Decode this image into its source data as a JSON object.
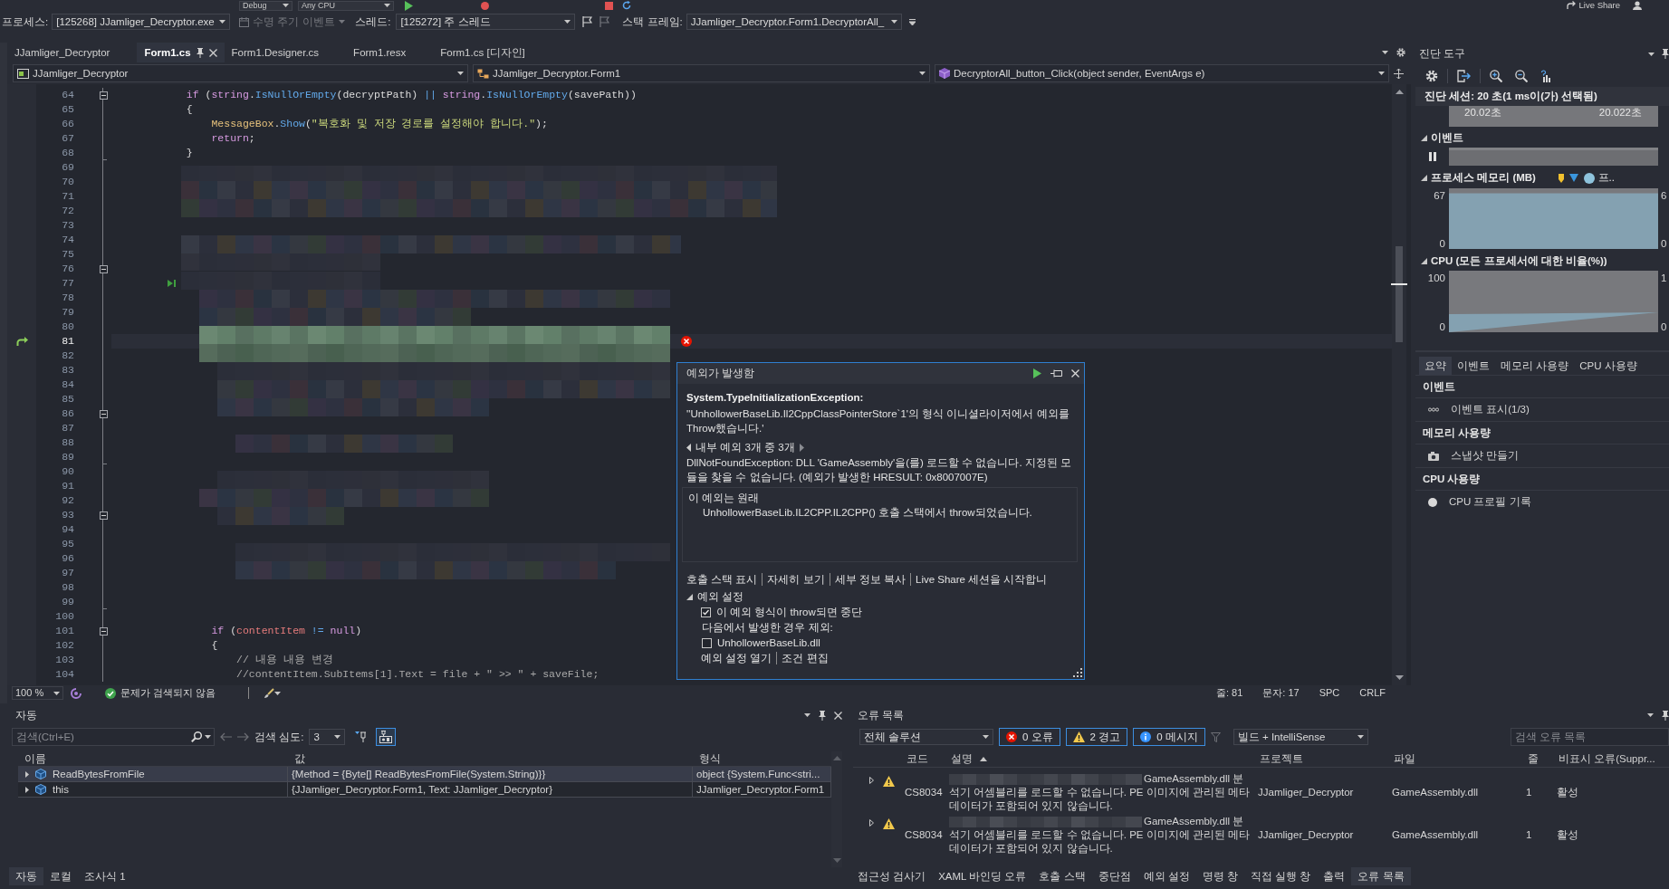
{
  "toolbar": {
    "configuration": "Debug",
    "platform": "Any CPU",
    "live_share": "Live Share"
  },
  "debug_location": {
    "process_label": "프로세스:",
    "process": "[125268] JJamliger_Decryptor.exe",
    "lifecycle_events": "수명 주기 이벤트",
    "thread_label": "스레드:",
    "thread": "[125272] 주 스레드",
    "stack_frame_label": "스택 프레임:",
    "stack_frame": "JJamliger_Decryptor.Form1.DecryptorAll_"
  },
  "editor": {
    "tabs": [
      {
        "label": "JJamliger_Decryptor",
        "selected": false
      },
      {
        "label": "Form1.cs",
        "selected": true
      },
      {
        "label": "Form1.Designer.cs",
        "selected": false
      },
      {
        "label": "Form1.resx",
        "selected": false
      },
      {
        "label": "Form1.cs [디자인]",
        "selected": false
      }
    ],
    "navigation": {
      "project": "JJamliger_Decryptor",
      "type": "JJamliger_Decryptor.Form1",
      "member": "DecryptorAll_button_Click(object sender, EventArgs e)"
    },
    "lines": [
      {
        "number": "64",
        "kind": "opener",
        "current": false,
        "hovered": false,
        "tokens": [
          {
            "kind": "keyword",
            "text": "            if"
          },
          {
            "kind": "plain",
            "text": " ("
          },
          {
            "kind": "keyword",
            "text": "string"
          },
          {
            "kind": "plain",
            "text": "."
          },
          {
            "kind": "method",
            "text": "IsNullOrEmpty"
          },
          {
            "kind": "plain",
            "text": "(decryptPath) "
          },
          {
            "kind": "operator",
            "text": "|| "
          },
          {
            "kind": "keyword",
            "text": "string"
          },
          {
            "kind": "plain",
            "text": "."
          },
          {
            "kind": "method",
            "text": "IsNullOrEmpty"
          },
          {
            "kind": "plain",
            "text": "(savePath))"
          }
        ]
      },
      {
        "number": "65",
        "kind": "plain",
        "current": false,
        "hovered": false,
        "tokens": [
          {
            "kind": "plain",
            "text": "            {"
          }
        ]
      },
      {
        "number": "66",
        "kind": "plain",
        "current": false,
        "hovered": false,
        "tokens": [
          {
            "kind": "type",
            "text": "                MessageBox"
          },
          {
            "kind": "plain",
            "text": "."
          },
          {
            "kind": "method",
            "text": "Show"
          },
          {
            "kind": "plain",
            "text": "("
          },
          {
            "kind": "string",
            "text": "\"복호화 및 저장 경로를 설정해야 합니다.\""
          },
          {
            "kind": "plain",
            "text": ");"
          }
        ]
      },
      {
        "number": "67",
        "kind": "plain",
        "current": false,
        "hovered": false,
        "tokens": [
          {
            "kind": "keyword",
            "text": "                return"
          },
          {
            "kind": "plain",
            "text": ";"
          }
        ]
      },
      {
        "number": "68",
        "kind": "closer",
        "current": false,
        "hovered": false,
        "tokens": [
          {
            "kind": "plain",
            "text": "            }"
          }
        ]
      },
      {
        "number": "69",
        "kind": "plain",
        "current": false,
        "hovered": false
      },
      {
        "number": "70",
        "kind": "plain",
        "current": false,
        "hovered": false
      },
      {
        "number": "71",
        "kind": "plain",
        "current": false,
        "hovered": false
      },
      {
        "number": "72",
        "kind": "plain",
        "current": false,
        "hovered": false
      },
      {
        "number": "73",
        "kind": "plain",
        "current": false,
        "hovered": false
      },
      {
        "number": "74",
        "kind": "plain",
        "current": false,
        "hovered": false
      },
      {
        "number": "75",
        "kind": "plain",
        "current": false,
        "hovered": false
      },
      {
        "number": "76",
        "kind": "opener",
        "current": false,
        "hovered": false
      },
      {
        "number": "77",
        "kind": "plain",
        "current": false,
        "hovered": true
      },
      {
        "number": "78",
        "kind": "plain",
        "current": false,
        "hovered": false
      },
      {
        "number": "79",
        "kind": "plain",
        "current": false,
        "hovered": false
      },
      {
        "number": "80",
        "kind": "plain",
        "current": false,
        "hovered": false
      },
      {
        "number": "81",
        "kind": "plain",
        "current": true,
        "hovered": false
      },
      {
        "number": "82",
        "kind": "plain",
        "current": false,
        "hovered": false
      },
      {
        "number": "83",
        "kind": "plain",
        "current": false,
        "hovered": false
      },
      {
        "number": "84",
        "kind": "plain",
        "current": false,
        "hovered": false
      },
      {
        "number": "85",
        "kind": "plain",
        "current": false,
        "hovered": false
      },
      {
        "number": "86",
        "kind": "opener",
        "current": false,
        "hovered": false
      },
      {
        "number": "87",
        "kind": "plain",
        "current": false,
        "hovered": false
      },
      {
        "number": "88",
        "kind": "plain",
        "current": false,
        "hovered": false
      },
      {
        "number": "89",
        "kind": "closer",
        "current": false,
        "hovered": false
      },
      {
        "number": "90",
        "kind": "plain",
        "current": false,
        "hovered": false
      },
      {
        "number": "91",
        "kind": "plain",
        "current": false,
        "hovered": false
      },
      {
        "number": "92",
        "kind": "plain",
        "current": false,
        "hovered": false
      },
      {
        "number": "93",
        "kind": "opener",
        "current": false,
        "hovered": false
      },
      {
        "number": "94",
        "kind": "plain",
        "current": false,
        "hovered": false
      },
      {
        "number": "95",
        "kind": "plain",
        "current": false,
        "hovered": false
      },
      {
        "number": "96",
        "kind": "plain",
        "current": false,
        "hovered": false
      },
      {
        "number": "97",
        "kind": "plain",
        "current": false,
        "hovered": false
      },
      {
        "number": "98",
        "kind": "plain",
        "current": false,
        "hovered": false
      },
      {
        "number": "99",
        "kind": "closer",
        "current": false,
        "hovered": false
      },
      {
        "number": "100",
        "kind": "plain",
        "current": false,
        "hovered": false
      },
      {
        "number": "101",
        "kind": "opener",
        "current": false,
        "hovered": false,
        "tokens": [
          {
            "kind": "keyword",
            "text": "                if"
          },
          {
            "kind": "plain",
            "text": " ("
          },
          {
            "kind": "variable",
            "text": "contentItem"
          },
          {
            "kind": "operator",
            "text": " != "
          },
          {
            "kind": "keyword",
            "text": "null"
          },
          {
            "kind": "plain",
            "text": ")"
          }
        ]
      },
      {
        "number": "102",
        "kind": "plain",
        "current": false,
        "hovered": false,
        "tokens": [
          {
            "kind": "plain",
            "text": "                {"
          }
        ]
      },
      {
        "number": "103",
        "kind": "plain",
        "current": false,
        "hovered": false,
        "tokens": [
          {
            "kind": "comment",
            "text": "                    // 내용 내용 변경"
          }
        ]
      },
      {
        "number": "104",
        "kind": "plain",
        "current": false,
        "hovered": false,
        "tokens": [
          {
            "kind": "comment",
            "text": "                    //contentItem.SubItems[1].Text = file + \" >> \" + saveFile;"
          }
        ]
      }
    ],
    "status": {
      "zoom": "100 %",
      "issues": "문제가 검색되지 않음",
      "line": "줄: 81",
      "character": "문자: 17",
      "whitespace": "SPC",
      "line_ending": "CRLF"
    }
  },
  "exception_popup": {
    "title": "예외가 발생함",
    "exception_type": "System.TypeInitializationException:",
    "message": "''UnhollowerBaseLib.Il2CppClassPointerStore`1'의 형식 이니셜라이저에서 예외를 Throw했습니다.'",
    "inner_navigation": "내부 예외 3개 중 3개",
    "inner_message": "DllNotFoundException: DLL 'GameAssembly'을(를) 로드할 수 없습니다. 지정된 모듈을 찾을 수 없습니다. (예외가 발생한 HRESULT: 0x8007007E)",
    "origin_heading": "이 예외는 원래",
    "origin_detail": "UnhollowerBaseLib.IL2CPP.IL2CPP() 호출 스택에서 throw되었습니다.",
    "actions": [
      "호출 스택 표시",
      "자세히 보기",
      "세부 정보 복사",
      "Live Share 세션을 시작합니"
    ],
    "settings": {
      "title": "예외 설정",
      "expanded": true,
      "options": [
        {
          "kind": "checkbox",
          "label": "이 예외 형식이 throw되면 중단",
          "checked": true,
          "children": [
            {
              "kind": "label",
              "label": "다음에서 발생한 경우 제외:"
            },
            {
              "kind": "checkbox",
              "label": "UnhollowerBaseLib.dll",
              "checked": false
            }
          ]
        }
      ],
      "links": [
        "예외 설정 열기",
        "조건 편집"
      ]
    }
  },
  "diagnostics": {
    "title": "진단 도구",
    "session": "진단 세션: 20 초(1 ms이(가) 선택됨)",
    "ruler_labels": [
      "20.02초",
      "20.022초"
    ],
    "events": {
      "title": "이벤트",
      "expanded": true
    },
    "memory": {
      "title": "프로세스 메모리 (MB)",
      "expanded": true,
      "legend": "프..",
      "axis_labels": [
        "67",
        "0"
      ],
      "right_axis_labels": [
        "6",
        "0"
      ]
    },
    "cpu": {
      "title": "CPU (모든 프로세서에 대한 비율(%))",
      "expanded": true,
      "axis_labels": [
        "100",
        "0"
      ],
      "right_axis_labels": [
        "1",
        "0"
      ]
    },
    "tabs": [
      {
        "label": "요약",
        "selected": true
      },
      {
        "label": "이벤트",
        "selected": false
      },
      {
        "label": "메모리 사용량",
        "selected": false
      },
      {
        "label": "CPU 사용량",
        "selected": false
      }
    ],
    "summary": [
      {
        "heading": "이벤트",
        "action": "이벤트 표시(1/3)",
        "kind": "events"
      },
      {
        "heading": "메모리 사용량",
        "action": "스냅샷 만들기",
        "kind": "snapshot"
      },
      {
        "heading": "CPU 사용량",
        "action": "CPU 프로필 기록",
        "kind": "record"
      }
    ]
  },
  "autos": {
    "title": "자동",
    "search_placeholder": "검색(Ctrl+E)",
    "depth_label": "검색 심도:",
    "depth": "3",
    "toggles": [
      {
        "kind": "pin",
        "on": false
      },
      {
        "kind": "raw",
        "on": true
      }
    ],
    "columns": [
      "이름",
      "값",
      "형식"
    ],
    "rows": [
      {
        "name": "ReadBytesFromFile",
        "value": "{Method = {Byte[] ReadBytesFromFile(System.String)}}",
        "type": "object {System.Func<stri...",
        "selected": true,
        "expanded": false
      },
      {
        "name": "this",
        "value": "{JJamliger_Decryptor.Form1, Text: JJamliger_Decryptor}",
        "type": "JJamliger_Decryptor.Form1",
        "selected": false,
        "expanded": false
      }
    ],
    "tabs": [
      {
        "label": "자동",
        "selected": true
      },
      {
        "label": "로컬",
        "selected": false
      },
      {
        "label": "조사식 1",
        "selected": false
      }
    ]
  },
  "error_list": {
    "title": "오류 목록",
    "scope": "전체 솔루션",
    "filters": [
      {
        "kind": "error",
        "label": "0 오류",
        "on": true
      },
      {
        "kind": "warning",
        "label": "2 경고",
        "on": true
      },
      {
        "kind": "message",
        "label": "0 메시지",
        "on": true
      }
    ],
    "source": "빌드 + IntelliSense",
    "search_placeholder": "검색 오류 목록",
    "columns": [
      {
        "label": "코드",
        "sorted": false
      },
      {
        "label": "설명",
        "sorted": true
      },
      {
        "label": "프로젝트",
        "sorted": false
      },
      {
        "label": "파일",
        "sorted": false
      },
      {
        "label": "줄",
        "sorted": false
      },
      {
        "label": "비표시 오류(Suppr...",
        "sorted": false
      }
    ],
    "rows": [
      {
        "kind": "warning",
        "expanded": false,
        "code": "CS8034",
        "redacted": true,
        "description": "GameAssembly.dll 분석기 어셈블리를 로드할 수 없습니다. PE 이미지에 관리된 메타데이터가 포함되어 있지 않습니다.",
        "project": "JJamliger_Decryptor",
        "file": "GameAssembly.dll",
        "line": "1",
        "suppression": "활성"
      },
      {
        "kind": "warning",
        "expanded": false,
        "code": "CS8034",
        "redacted": true,
        "description": "GameAssembly.dll 분석기 어셈블리를 로드할 수 없습니다. PE 이미지에 관리된 메타데이터가 포함되어 있지 않습니다.",
        "project": "JJamliger_Decryptor",
        "file": "GameAssembly.dll",
        "line": "1",
        "suppression": "활성"
      }
    ],
    "tabs": [
      {
        "label": "접근성 검사기",
        "selected": false
      },
      {
        "label": "XAML 바인딩 오류",
        "selected": false
      },
      {
        "label": "호출 스택",
        "selected": false
      },
      {
        "label": "중단점",
        "selected": false
      },
      {
        "label": "예외 설정",
        "selected": false
      },
      {
        "label": "명령 창",
        "selected": false
      },
      {
        "label": "직접 실행 창",
        "selected": false
      },
      {
        "label": "출력",
        "selected": false
      },
      {
        "label": "오류 목록",
        "selected": true
      }
    ]
  }
}
